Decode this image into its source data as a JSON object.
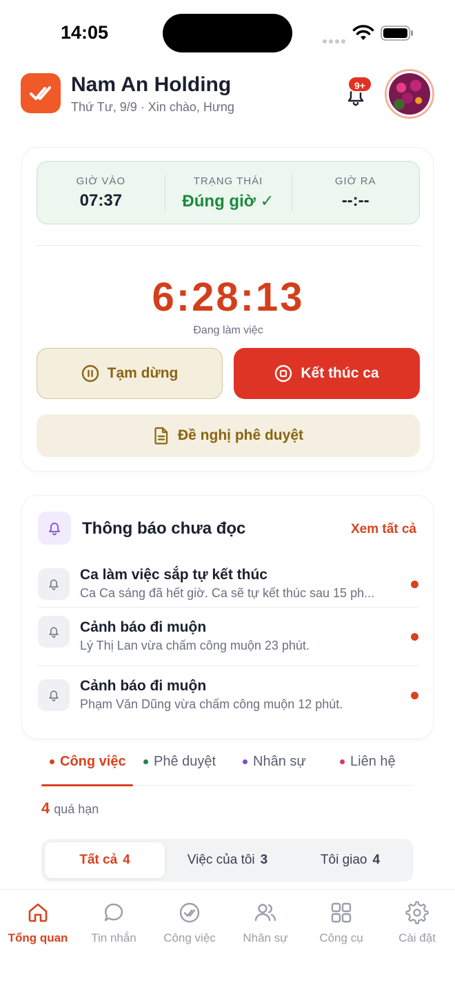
{
  "status_bar": {
    "time": "14:05"
  },
  "header": {
    "company": "Nam An Holding",
    "subtitle": "Thứ Tư, 9/9 · Xin chào, Hưng",
    "notification_badge": "9+"
  },
  "attendance": {
    "check_in_label": "GIỜ VÀO",
    "check_in_value": "07:37",
    "status_label": "TRẠNG THÁI",
    "status_value": "Đúng giờ ✓",
    "check_out_label": "GIỜ RA",
    "check_out_value": "--:--",
    "timer": "6:28:13",
    "timer_caption": "Đang làm việc",
    "pause_label": "Tạm dừng",
    "end_label": "Kết thúc ca",
    "approval_label": "Đề nghị phê duyệt"
  },
  "notifications": {
    "title": "Thông báo chưa đọc",
    "see_all": "Xem tất cả",
    "items": [
      {
        "title": "Ca làm việc sắp tự kết thúc",
        "desc": "Ca Ca sáng đã hết giờ. Ca sẽ tự kết thúc sau 15 ph..."
      },
      {
        "title": "Cảnh báo đi muộn",
        "desc": "Lý Thị Lan vừa chấm công muộn 23 phút."
      },
      {
        "title": "Cảnh báo đi muộn",
        "desc": "Phạm Văn Dũng vừa chấm công muộn 12 phút."
      }
    ]
  },
  "tabs": [
    {
      "label": "Công việc",
      "dot_color": "#d8421e"
    },
    {
      "label": "Phê duyệt",
      "dot_color": "#1c8a3e"
    },
    {
      "label": "Nhân sự",
      "dot_color": "#7b4ce0"
    },
    {
      "label": "Liên hệ",
      "dot_color": "#d93a6a"
    }
  ],
  "overdue": {
    "count": "4",
    "label": "quá hạn"
  },
  "filters": [
    {
      "label": "Tất cả",
      "count": "4"
    },
    {
      "label": "Việc của tôi",
      "count": "3"
    },
    {
      "label": "Tôi giao",
      "count": "4"
    }
  ],
  "bottom_nav": [
    {
      "label": "Tổng quan",
      "icon": "home-icon"
    },
    {
      "label": "Tin nhắn",
      "icon": "chat-icon"
    },
    {
      "label": "Công việc",
      "icon": "task-check-icon"
    },
    {
      "label": "Nhân sự",
      "icon": "people-icon"
    },
    {
      "label": "Công cụ",
      "icon": "grid-icon"
    },
    {
      "label": "Cài đặt",
      "icon": "gear-icon"
    }
  ],
  "colors": {
    "accent": "#d8421e",
    "danger": "#de3426",
    "success": "#1c8a3e"
  }
}
